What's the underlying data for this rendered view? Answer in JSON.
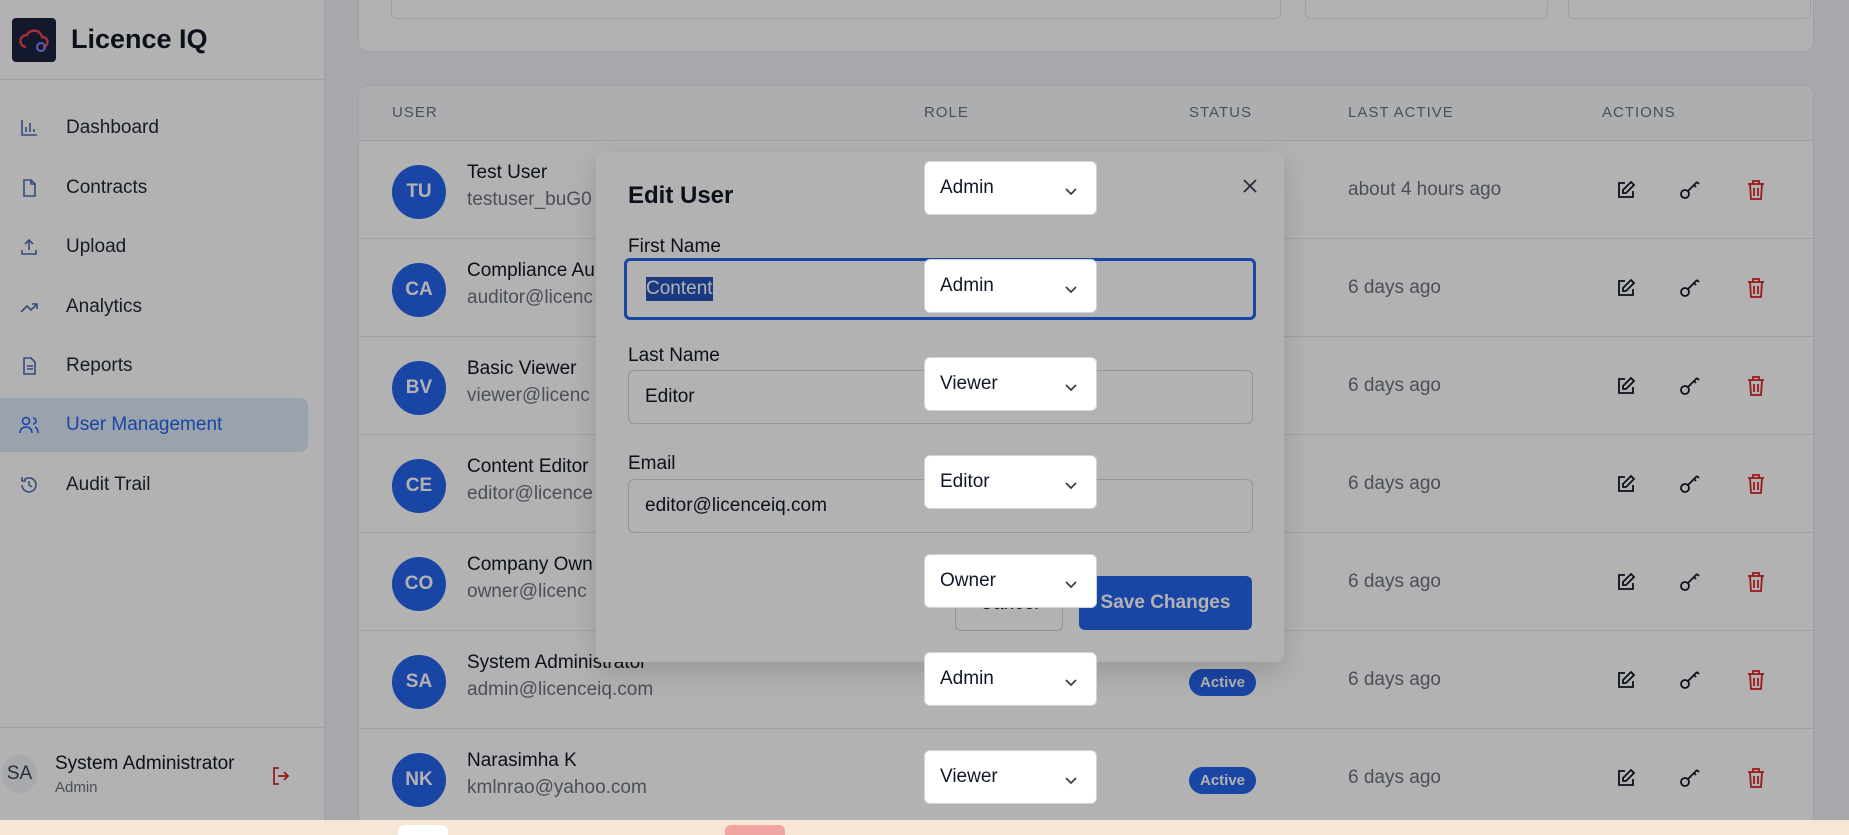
{
  "app": {
    "title": "Licence IQ"
  },
  "sidebar": {
    "items": [
      {
        "label": "Dashboard",
        "icon": "bar-chart-icon"
      },
      {
        "label": "Contracts",
        "icon": "document-icon"
      },
      {
        "label": "Upload",
        "icon": "upload-icon"
      },
      {
        "label": "Analytics",
        "icon": "trending-up-icon"
      },
      {
        "label": "Reports",
        "icon": "report-icon"
      },
      {
        "label": "User Management",
        "icon": "users-icon",
        "active": true
      },
      {
        "label": "Audit Trail",
        "icon": "history-icon"
      }
    ],
    "user": {
      "initials": "SA",
      "name": "System Administrator",
      "role": "Admin"
    }
  },
  "table": {
    "headers": {
      "user": "USER",
      "role": "ROLE",
      "status": "STATUS",
      "last_active": "LAST ACTIVE",
      "actions": "ACTIONS"
    },
    "rows": [
      {
        "initials": "TU",
        "name": "Test User",
        "email": "testuser_buG0",
        "role": "Admin",
        "status": "",
        "last_active": "about 4 hours ago"
      },
      {
        "initials": "CA",
        "name": "Compliance Au",
        "email": "auditor@licenc",
        "role": "Admin",
        "status": "",
        "last_active": "6 days ago"
      },
      {
        "initials": "BV",
        "name": "Basic Viewer",
        "email": "viewer@licenc",
        "role": "Viewer",
        "status": "",
        "last_active": "6 days ago"
      },
      {
        "initials": "CE",
        "name": "Content Editor",
        "email": "editor@licence",
        "role": "Editor",
        "status": "",
        "last_active": "6 days ago"
      },
      {
        "initials": "CO",
        "name": "Company Own",
        "email": "owner@licenc",
        "role": "Owner",
        "status": "",
        "last_active": "6 days ago"
      },
      {
        "initials": "SA",
        "name": "System Administrator",
        "email": "admin@licenceiq.com",
        "role": "Admin",
        "status": "Active",
        "last_active": "6 days ago"
      },
      {
        "initials": "NK",
        "name": "Narasimha K",
        "email": "kmlnrao@yahoo.com",
        "role": "Viewer",
        "status": "Active",
        "last_active": "6 days ago"
      }
    ]
  },
  "modal": {
    "title": "Edit User",
    "first_name_label": "First Name",
    "first_name_value": "Content",
    "last_name_label": "Last Name",
    "last_name_value": "Editor",
    "email_label": "Email",
    "email_value": "editor@licenceiq.com",
    "cancel_label": "Cancel",
    "save_label": "Save Changes"
  },
  "colors": {
    "accent": "#2563eb",
    "danger": "#dc2626"
  }
}
